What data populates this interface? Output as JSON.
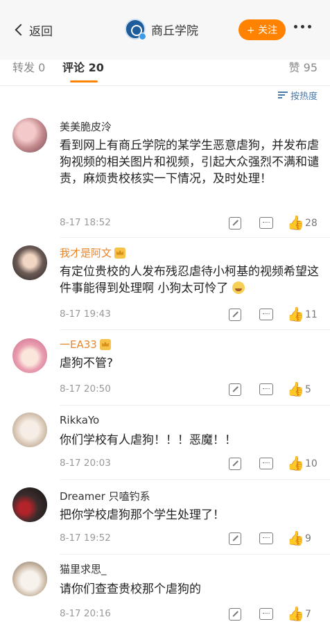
{
  "header": {
    "back_label": "返回",
    "account_name": "商丘学院",
    "follow_label": "+ 关注"
  },
  "tabs": {
    "repost": "转发 0",
    "comments": "评论 20",
    "likes": "赞 95"
  },
  "sort_label": "按热度",
  "comments": [
    {
      "name": "美美脆皮泠",
      "name_color": "#333333",
      "vip": false,
      "text": "看到网上有商丘学院的某学生恶意虐狗，并发布虐狗视频的相关图片和视频，引起大众强烈不满和谴责，麻烦贵校核实一下情况，及时处理！",
      "date": "8-17 18:52",
      "likes": "28"
    },
    {
      "name": "我才是阿文",
      "name_color": "#e8862b",
      "vip": true,
      "text": "有定位贵校的人发布残忍虐待小柯基的视频希望这件事能得到处理啊 小狗太可怜了",
      "date": "8-17 19:43",
      "likes": "11"
    },
    {
      "name": "一EA33",
      "name_color": "#e8862b",
      "vip": true,
      "text": "虐狗不管?",
      "date": "8-17 20:50",
      "likes": "5"
    },
    {
      "name": "RikkaYo",
      "name_color": "#333333",
      "vip": false,
      "text": "你们学校有人虐狗！！！恶魔！！",
      "date": "8-17 20:03",
      "likes": "10"
    },
    {
      "name": "Dreamer 只嗑钓系",
      "name_color": "#333333",
      "vip": false,
      "text": "把你学校虐狗那个学生处理了！",
      "date": "8-17 19:52",
      "likes": "9"
    },
    {
      "name": "猫里求思_",
      "name_color": "#333333",
      "vip": false,
      "text": "请你们查查贵校那个虐狗的",
      "date": "8-17 20:16",
      "likes": "7"
    }
  ],
  "colors": {
    "accent": "#ff8200",
    "link": "#4a78a8"
  }
}
